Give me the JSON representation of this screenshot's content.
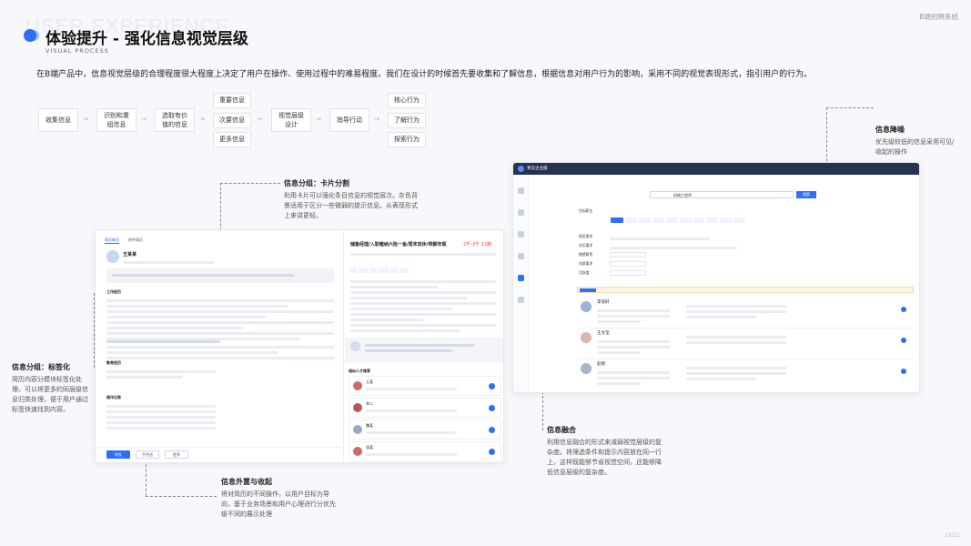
{
  "header": {
    "bg_word": "USER EXPERIENCE",
    "title": "体验提升 - 强化信息视觉层级",
    "subtitle": "VISUAL PROCESS",
    "brand": "B端招聘系统",
    "intro": "在B端产品中，信息视觉层级的合理程度很大程度上决定了用户在操作、使用过程中的难易程度。我们在设计的时候首先要收集和了解信息，根据信息对用户行为的影响，采用不同的视觉表现形式，指引用户的行为。"
  },
  "flow": {
    "collect": "收集信息",
    "identify": "识别和重\n组信息",
    "select": "选取有价\n值的信息",
    "important": "重要信息",
    "secondary": "次要信息",
    "more": "更多信息",
    "design": "视觉层级\n设计",
    "guide": "指导行动",
    "core": "核心行为",
    "learn": "了解行为",
    "explore": "探索行为"
  },
  "annotations": {
    "card_title": "信息分组：卡片分割",
    "card_body": "利用卡片可以强化条目信息的视觉层次。灰色背景适用于区分一些微弱的提示信息。从表现形式上来讲更轻。",
    "tag_title": "信息分组：标签化",
    "tag_body": "简历内容分模块标签化处理，可以将更多的同层级信息归类处理，便于用户通过标签快速找到内容。",
    "outside_title": "信息外置与收起",
    "outside_body": "将对简历的不同操作，以用户目标为导向，基于业务场景和用户心理进行分优先级不同的展示处理",
    "fusion_title": "信息融合",
    "fusion_body": "利用信息融合的形式来减弱视觉层级的复杂度。将筛选条件和提示内容放在同一行上，这样既能够节省视觉空间，还能够降低信息层级的复杂度。",
    "reduce_title": "信息降噪",
    "reduce_body": "优先级较低的信息采用可见/收起的操作"
  },
  "left_mock": {
    "tab1": "简历概览",
    "tab2": "附件简历",
    "name": "王某某",
    "job_title": "储备经理/入职缴纳六险一金/周末双休/带薪年假",
    "salary": "2千-3千·13薪",
    "btn_primary": "转发",
    "btn2": "不合适",
    "btn3": "更多",
    "section_work": "工作经历",
    "section_edu": "教育经历",
    "section_log": "操作记录",
    "section_rec": "相似人才推荐",
    "people": [
      {
        "name": "王某"
      },
      {
        "name": "李二"
      },
      {
        "name": "魏某"
      },
      {
        "name": "张某"
      }
    ]
  },
  "right_mock": {
    "app_name": "青云企业版",
    "search_value": "机械工程师",
    "search_btn": "搜索",
    "filters": [
      "目标职位",
      "经验要求",
      "学历要求",
      "期望薪资",
      "年龄要求",
      "活跃度"
    ],
    "candidates": [
      {
        "name": "李浩轩"
      },
      {
        "name": "王文莹"
      },
      {
        "name": "赵刚"
      }
    ]
  },
  "page_no": "10/21"
}
